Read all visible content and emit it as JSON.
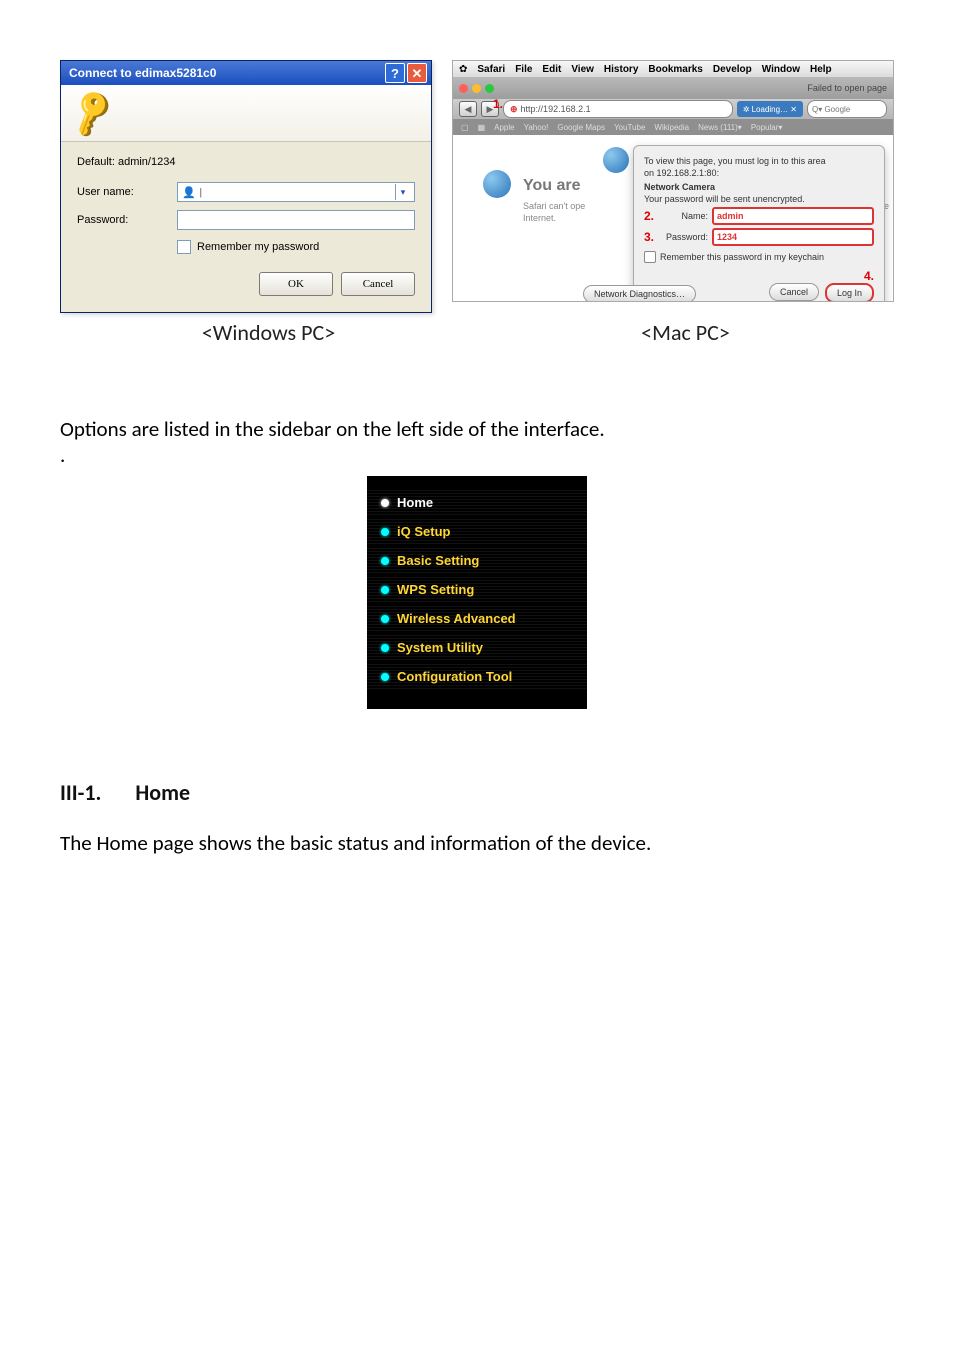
{
  "win": {
    "title": "Connect to edimax5281c0",
    "default_hint": "Default: admin/1234",
    "user_label": "User name:",
    "pass_label": "Password:",
    "user_value": "",
    "remember": "Remember my password",
    "ok": "OK",
    "cancel": "Cancel"
  },
  "mac": {
    "menu": [
      "Safari",
      "File",
      "Edit",
      "View",
      "History",
      "Bookmarks",
      "Develop",
      "Window",
      "Help"
    ],
    "fail": "Failed to open page",
    "url": "http://192.168.2.1",
    "loading": "Loading… ✕",
    "gsearch": "Q▾ Google",
    "bookmarks": [
      "Apple",
      "Yahoo!",
      "Google Maps",
      "YouTube",
      "Wikipedia",
      "News (111)▾",
      "Popular▾"
    ],
    "big": "You are",
    "sub1": "Safari can't ope",
    "sub2": "Internet.",
    "trail": "n't conne",
    "sheet": {
      "l1a": "To view this page, you must log in to this area",
      "l1b": "on 192.168.2.1:80:",
      "l2": "Network Camera",
      "l3": "Your password will be sent unencrypted.",
      "name_l": "Name:",
      "name_v": "admin",
      "pass_l": "Password:",
      "pass_v": "1234",
      "remember": "Remember this password in my keychain",
      "cancel": "Cancel",
      "login": "Log In"
    },
    "diag": "Network Diagnostics…",
    "annot": {
      "a1": "1.",
      "a2": "2.",
      "a3": "3.",
      "a4": "4."
    }
  },
  "captions": {
    "win": "<Windows PC>",
    "mac": "<Mac PC>"
  },
  "para": "Options are listed in the sidebar on the left side of the interface.",
  "sidebar": [
    "Home",
    "iQ Setup",
    "Basic Setting",
    "WPS Setting",
    "Wireless Advanced",
    "System Utility",
    "Configuration Tool"
  ],
  "section": {
    "num": "III-1.",
    "title": "Home"
  },
  "section_text": "The Home page shows the basic status and information of the device."
}
